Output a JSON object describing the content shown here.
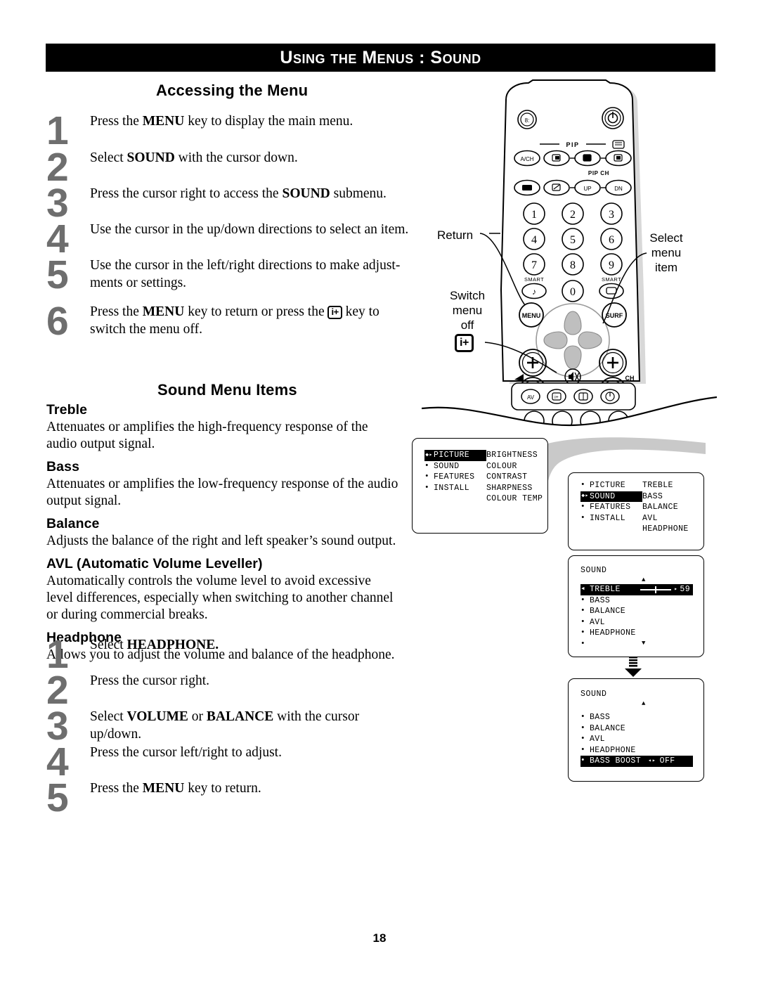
{
  "header": {
    "title": "Using the Menus : Sound"
  },
  "sections": {
    "accessing_title": "Accessing the Menu",
    "sound_items_title": "Sound Menu Items"
  },
  "accessing_steps": [
    {
      "num": "1",
      "text_before": "Press the ",
      "bold1": "MENU",
      "text_after": " key to display the main menu."
    },
    {
      "num": "2",
      "text_before": "Select ",
      "bold1": "SOUND",
      "text_after": " with the cursor down."
    },
    {
      "num": "3",
      "text_before": "Press the cursor right to access the ",
      "bold1": "SOUND",
      "text_after": " submenu."
    },
    {
      "num": "4",
      "text_before": "Use the cursor in the up/down directions to select an item.",
      "bold1": "",
      "text_after": ""
    },
    {
      "num": "5",
      "text_before": "Use the cursor in the left/right directions to make adjust-ments or settings.",
      "bold1": "",
      "text_after": ""
    },
    {
      "num": "6",
      "text_before": "Press the ",
      "bold1": "MENU",
      "text_after": " key to return or press the ",
      "key": "i+",
      "text_end": " key to switch the menu off."
    }
  ],
  "menu_items": [
    {
      "title": "Treble",
      "body": "Attenuates or amplifies the high-frequency response of the audio output signal."
    },
    {
      "title": "Bass",
      "body": "Attenuates or amplifies the low-frequency response of the audio output signal."
    },
    {
      "title": "Balance",
      "body": "Adjusts the balance of the right and left speaker’s sound output."
    },
    {
      "title": "AVL (Automatic Volume Leveller)",
      "body": "Automatically controls the volume level to avoid excessive level differences, especially when switching to another channel or during commercial breaks."
    },
    {
      "title": "Headphone",
      "body": "Allows you to adjust the volume and balance of the headphone."
    }
  ],
  "headphone_steps": [
    {
      "num": "1",
      "text_before": "Select ",
      "bold1": "HEADPHONE.",
      "text_after": ""
    },
    {
      "num": "2",
      "text_before": "Press the cursor right.",
      "bold1": "",
      "text_after": ""
    },
    {
      "num": "3",
      "text_before": "Select ",
      "bold1": "VOLUME",
      "mid": " or ",
      "bold2": "BALANCE",
      "text_after": " with the cursor up/down."
    },
    {
      "num": "4",
      "text_before": "Press the cursor left/right to adjust.",
      "bold1": "",
      "text_after": ""
    },
    {
      "num": "5",
      "text_before": "Press the ",
      "bold1": "MENU",
      "text_after": " key to return."
    }
  ],
  "remote": {
    "callouts": {
      "return": "Return",
      "select_menu_item": "Select\nmenu\nitem",
      "switch_menu_off": "Switch\nmenu\noff",
      "iplus_key": "i+"
    },
    "buttons": {
      "ach": "A/CH",
      "pip_label": "PIP",
      "pip_ch_label": "PIP CH",
      "pip_up": "UP",
      "pip_dn": "DN",
      "menu": "MENU",
      "surf": "SURF",
      "smart_left": "SMART",
      "smart_right": "SMART",
      "ch_label": "CH",
      "av": "AV",
      "keys": [
        "1",
        "2",
        "3",
        "4",
        "5",
        "6",
        "7",
        "8",
        "9",
        "0"
      ]
    }
  },
  "osd_panels": [
    {
      "id": "picture-menu",
      "left_items": [
        {
          "label": "PICTURE",
          "selected": true
        },
        {
          "label": "SOUND",
          "selected": false
        },
        {
          "label": "FEATURES",
          "selected": false
        },
        {
          "label": "INSTALL",
          "selected": false
        }
      ],
      "right_items": [
        "BRIGHTNESS",
        "COLOUR",
        "CONTRAST",
        "SHARPNESS",
        "COLOUR TEMP"
      ]
    },
    {
      "id": "sound-menu",
      "left_items": [
        {
          "label": "PICTURE",
          "selected": false
        },
        {
          "label": "SOUND",
          "selected": true
        },
        {
          "label": "FEATURES",
          "selected": false
        },
        {
          "label": "INSTALL",
          "selected": false
        }
      ],
      "right_items": [
        "TREBLE",
        "BASS",
        "BALANCE",
        "AVL",
        "HEADPHONE"
      ]
    },
    {
      "id": "sound-submenu-treble",
      "heading": "SOUND",
      "items": [
        {
          "label": "TREBLE",
          "selected": true,
          "value": "59",
          "has_slider": true
        },
        {
          "label": "BASS",
          "selected": false
        },
        {
          "label": "BALANCE",
          "selected": false
        },
        {
          "label": "AVL",
          "selected": false
        },
        {
          "label": "HEADPHONE",
          "selected": false
        },
        {
          "label": "",
          "selected": false
        }
      ]
    },
    {
      "id": "sound-submenu-bass-boost",
      "heading": "SOUND",
      "items": [
        {
          "label": "BASS",
          "selected": false
        },
        {
          "label": "BALANCE",
          "selected": false
        },
        {
          "label": "AVL",
          "selected": false
        },
        {
          "label": "HEADPHONE",
          "selected": false
        },
        {
          "label": "BASS BOOST",
          "selected": true,
          "value": "OFF"
        }
      ]
    }
  ],
  "page": {
    "number": "18"
  }
}
